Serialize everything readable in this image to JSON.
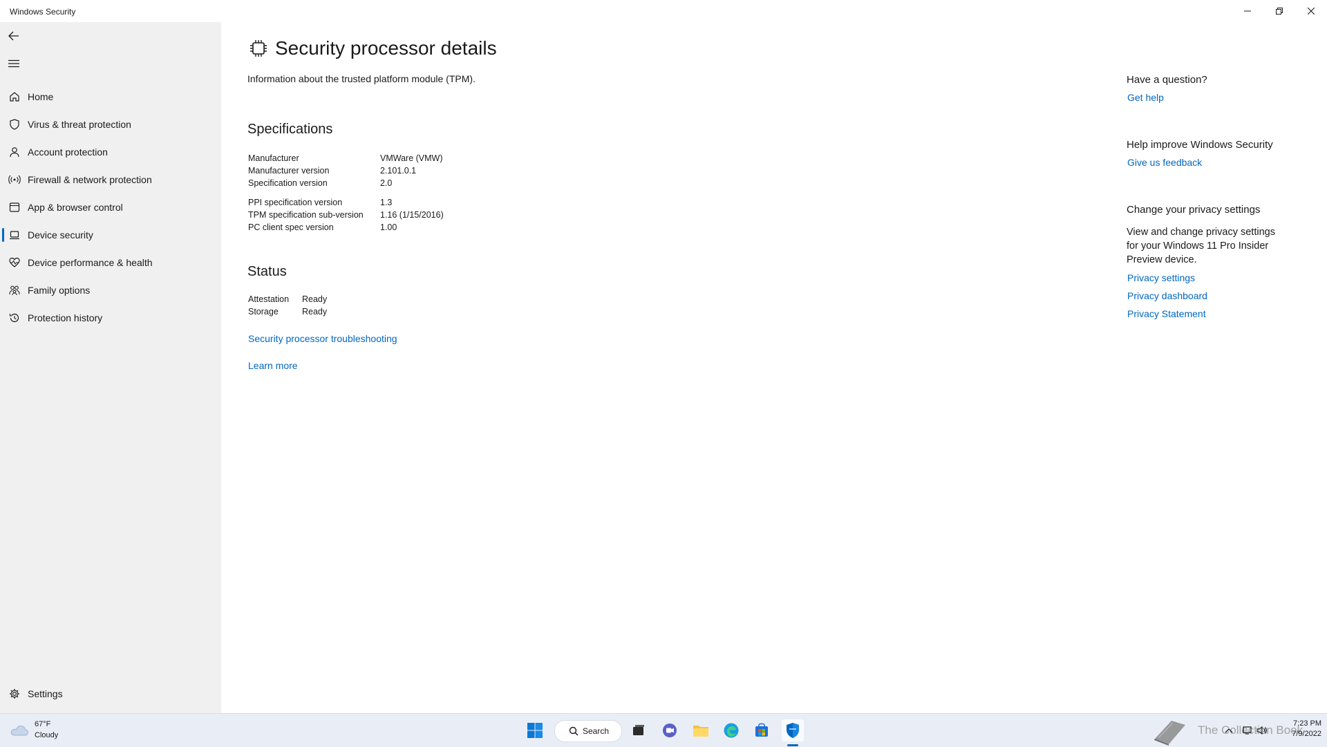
{
  "window": {
    "title": "Windows Security",
    "controls": {
      "minimize": "minimize-icon",
      "restore": "restore-icon",
      "close": "close-icon"
    }
  },
  "sidebar": {
    "back_icon": "back-arrow-icon",
    "menu_icon": "hamburger-menu-icon",
    "items": [
      {
        "label": "Home",
        "icon": "home-icon"
      },
      {
        "label": "Virus & threat protection",
        "icon": "shield-icon"
      },
      {
        "label": "Account protection",
        "icon": "person-icon"
      },
      {
        "label": "Firewall & network protection",
        "icon": "wifi-icon"
      },
      {
        "label": "App & browser control",
        "icon": "app-window-icon"
      },
      {
        "label": "Device security",
        "icon": "laptop-icon",
        "selected": true
      },
      {
        "label": "Device performance & health",
        "icon": "heart-icon"
      },
      {
        "label": "Family options",
        "icon": "family-icon"
      },
      {
        "label": "Protection history",
        "icon": "history-icon"
      }
    ],
    "settings_label": "Settings",
    "settings_icon": "gear-icon"
  },
  "main": {
    "title": "Security processor details",
    "title_icon": "chip-icon",
    "subtitle": "Information about the trusted platform module (TPM).",
    "specifications": {
      "heading": "Specifications",
      "rows": [
        {
          "key": "Manufacturer",
          "value": "VMWare (VMW)"
        },
        {
          "key": "Manufacturer version",
          "value": "2.101.0.1"
        },
        {
          "key": "Specification version",
          "value": "2.0"
        },
        {
          "key": "PPI specification version",
          "value": "1.3"
        },
        {
          "key": "TPM specification sub-version",
          "value": "1.16 (1/15/2016)"
        },
        {
          "key": "PC client spec version",
          "value": "1.00"
        }
      ]
    },
    "status": {
      "heading": "Status",
      "rows": [
        {
          "key": "Attestation",
          "value": "Ready"
        },
        {
          "key": "Storage",
          "value": "Ready"
        }
      ]
    },
    "troubleshooting_link": "Security processor troubleshooting",
    "learn_more_link": "Learn more"
  },
  "right": {
    "question_heading": "Have a question?",
    "get_help": "Get help",
    "improve_heading": "Help improve Windows Security",
    "feedback": "Give us feedback",
    "privacy_heading": "Change your privacy settings",
    "privacy_text": "View and change privacy settings for your Windows 11 Pro Insider Preview device.",
    "privacy_settings": "Privacy settings",
    "privacy_dashboard": "Privacy dashboard",
    "privacy_statement": "Privacy Statement"
  },
  "taskbar": {
    "weather_temp": "67°F",
    "weather_cond": "Cloudy",
    "search_label": "Search",
    "watermark": "The Collection Book",
    "time": "7:23 PM",
    "date": "7/9/2022",
    "accent": "#0067c0"
  }
}
